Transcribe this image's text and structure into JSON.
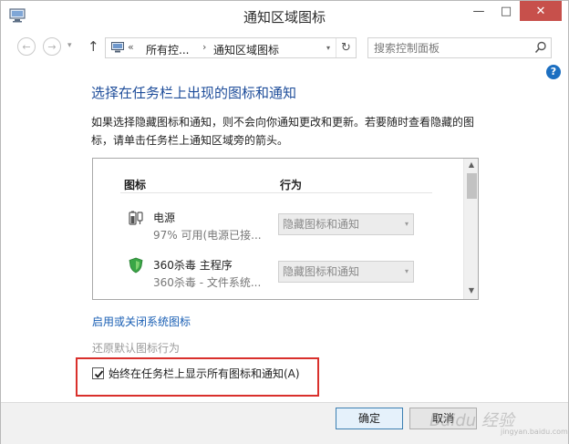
{
  "window": {
    "title": "通知区域图标",
    "minimize": "—",
    "maximize": "□",
    "close": "✕"
  },
  "nav": {
    "back_glyph": "←",
    "forward_glyph": "→",
    "history_glyph": "▾",
    "up_glyph": "↑",
    "breadcrumb": {
      "sep1": "«",
      "item1": "所有控...",
      "sep2": "›",
      "item2": "通知区域图标"
    },
    "dropdown_glyph": "▾",
    "refresh_glyph": "↻"
  },
  "search": {
    "placeholder": "搜索控制面板"
  },
  "help": {
    "glyph": "?"
  },
  "heading": "选择在任务栏上出现的图标和通知",
  "description": "如果选择隐藏图标和通知，则不会向你通知更改和更新。若要随时查看隐藏的图标，请单击任务栏上通知区域旁的箭头。",
  "table": {
    "col_icons": "图标",
    "col_behavior": "行为",
    "rows": [
      {
        "name": "电源",
        "detail": "97% 可用(电源已接...",
        "behavior": "隐藏图标和通知",
        "icon": "power-icon"
      },
      {
        "name": "360杀毒 主程序",
        "detail": "360杀毒 - 文件系统...",
        "behavior": "隐藏图标和通知",
        "icon": "antivirus-shield-icon"
      }
    ],
    "scroll_up": "▲",
    "scroll_down": "▼",
    "select_caret": "▾"
  },
  "links": {
    "system_icons": "启用或关闭系统图标",
    "restore_defaults": "还原默认图标行为"
  },
  "checkbox": {
    "label": "始终在任务栏上显示所有图标和通知(A)",
    "checked": true
  },
  "buttons": {
    "ok": "确定",
    "cancel": "取消"
  },
  "watermark": {
    "text": "Baidu 经验",
    "sub": "jingyan.baidu.com"
  },
  "colors": {
    "accent": "#1e4d9a",
    "link": "#1a5fb4",
    "close": "#c7504b",
    "highlight": "#d9302c"
  }
}
